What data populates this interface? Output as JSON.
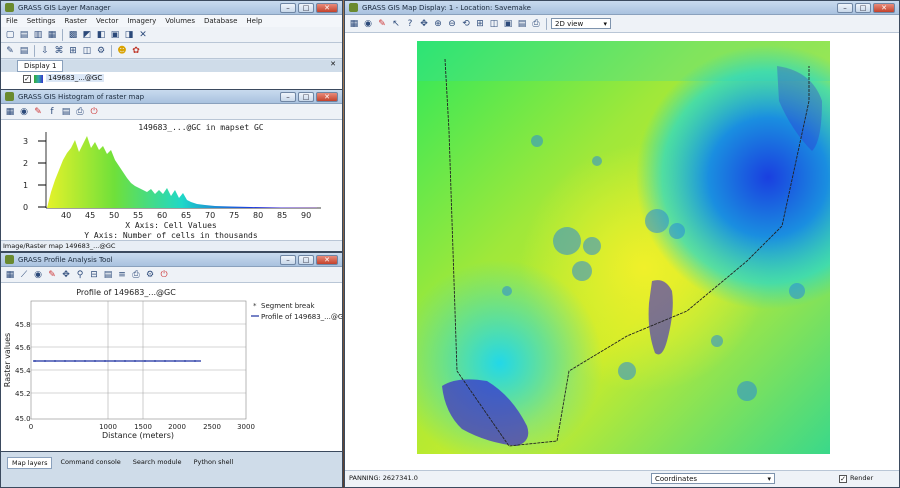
{
  "layer_manager": {
    "title": "GRASS GIS Layer Manager",
    "menu": [
      "File",
      "Settings",
      "Raster",
      "Vector",
      "Imagery",
      "Volumes",
      "Database",
      "Help"
    ],
    "display_tab": "Display 1",
    "layer_item": "149683_...@GC"
  },
  "histogram": {
    "title": "GRASS GIS Histogram of raster map",
    "plot_title": "149683_...@GC  in mapset GC",
    "y_ticks": [
      "3",
      "2",
      "1",
      "0"
    ],
    "x_ticks": [
      "40",
      "45",
      "50",
      "55",
      "60",
      "65",
      "70",
      "75",
      "80",
      "85",
      "90"
    ],
    "x_caption": "X Axis: Cell Values",
    "y_caption": "Y Axis: Number of cells in thousands",
    "status": "Image/Raster map 149683_...@GC"
  },
  "profile": {
    "title": "GRASS Profile Analysis Tool",
    "plot_title": "Profile of 149683_...@GC",
    "ylabel": "Raster values",
    "xlabel": "Distance (meters)",
    "y_ticks": [
      "45.8",
      "45.6",
      "45.4",
      "45.2",
      "45.0"
    ],
    "x_ticks": [
      "0",
      "1000",
      "1500",
      "2000",
      "2500",
      "3000"
    ],
    "legend": [
      "Segment break",
      "Profile of 149683_...@GC"
    ],
    "value": 45.45
  },
  "bottom_tabs": [
    "Map layers",
    "Command console",
    "Search module",
    "Python shell"
  ],
  "map_display": {
    "title": "GRASS GIS Map Display: 1 - Location: Savemake",
    "view_select": "2D view",
    "status_left": "PANNING: 2627341.0",
    "coordinates_select": "Coordinates",
    "render_label": "Render"
  },
  "colors": {
    "accent": "#2d5fa8",
    "profile_line": "#1a2fa0",
    "window_frame": "#d9e4f1"
  }
}
